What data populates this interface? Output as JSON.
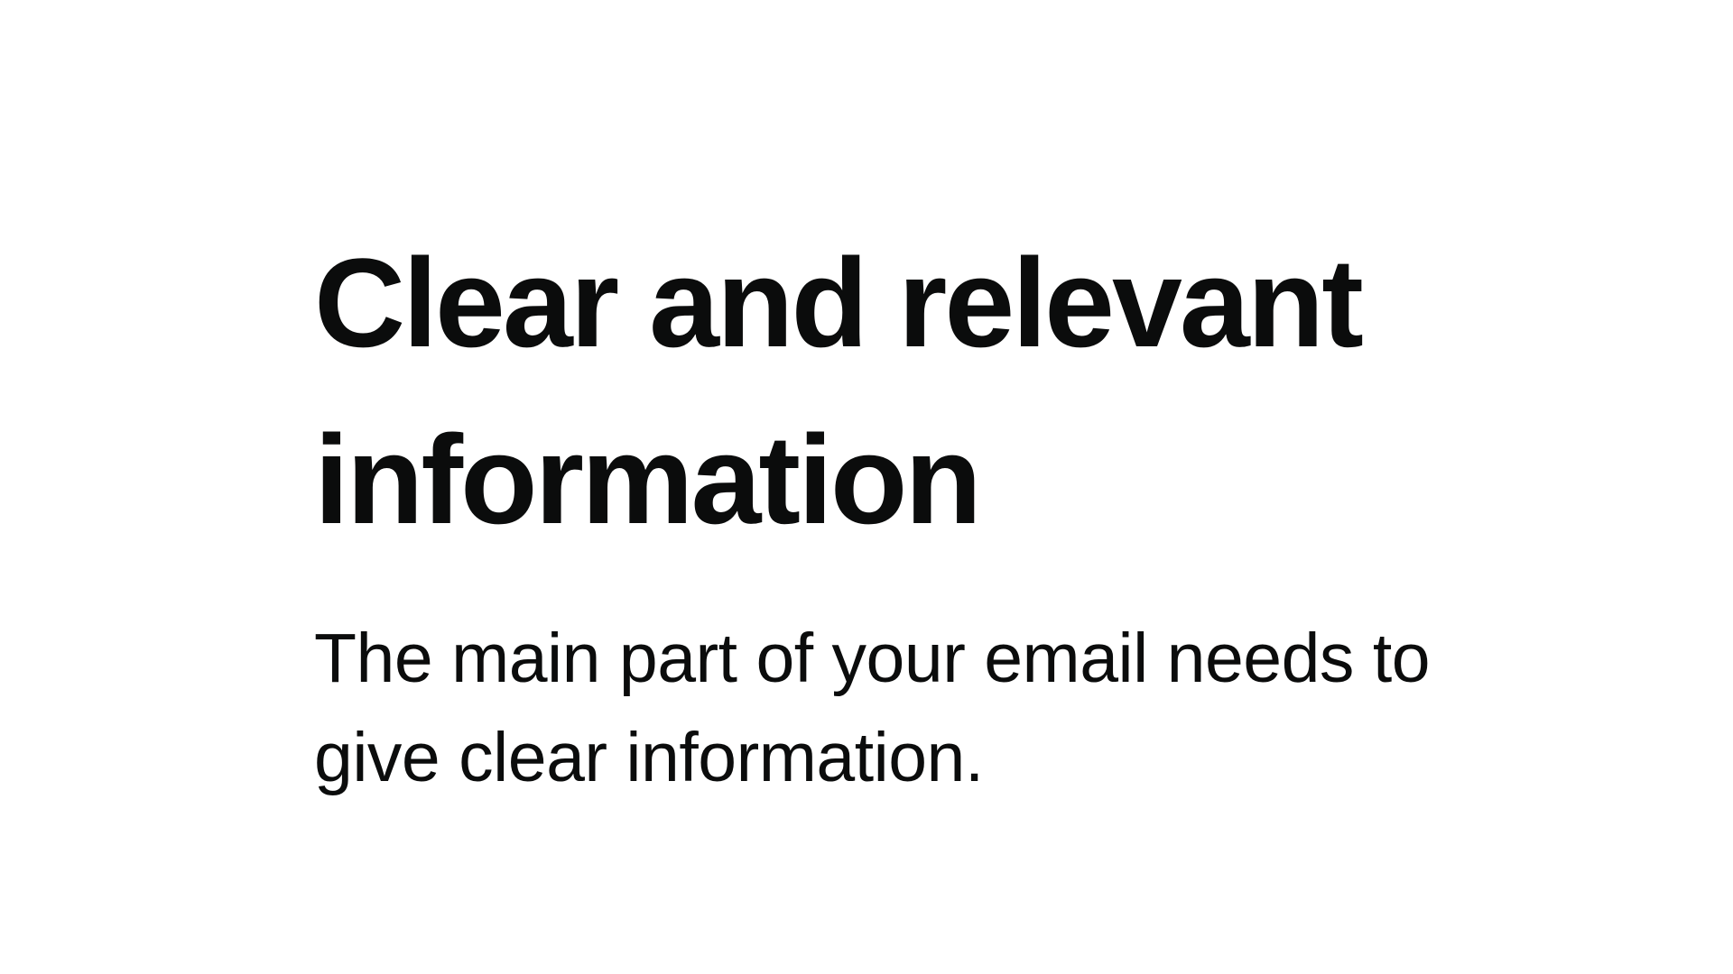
{
  "slide": {
    "title": "Clear and relevant information",
    "body": "The main part of your email needs to give clear information."
  },
  "colors": {
    "background": "#ffffff",
    "text": "#0b0c0c"
  }
}
